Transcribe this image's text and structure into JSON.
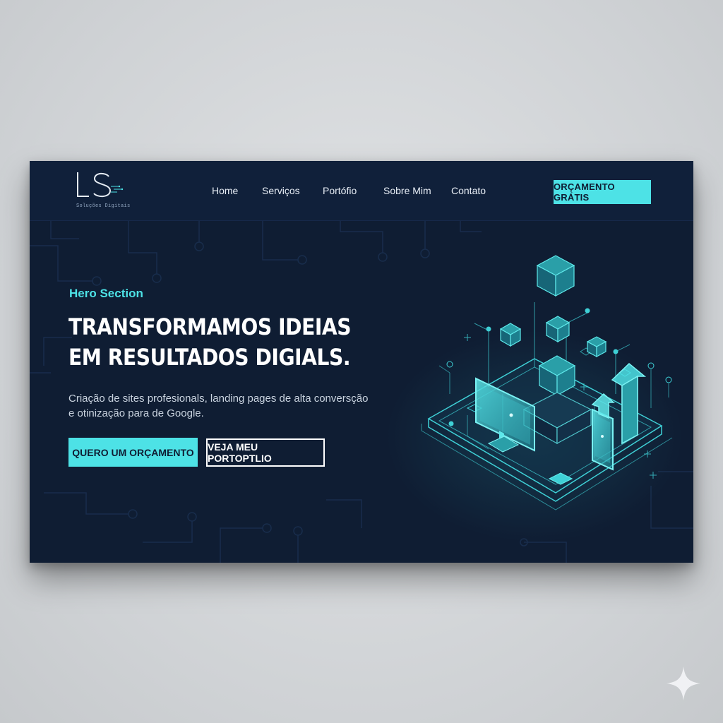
{
  "brand": {
    "logo_text": "LS",
    "tagline": "Soluções Digitais"
  },
  "nav": {
    "items": [
      {
        "label": "Home"
      },
      {
        "label": "Serviços"
      },
      {
        "label": "Portófio"
      },
      {
        "label": "Sobre Mim"
      },
      {
        "label": "Contato"
      }
    ],
    "cta_label": "ORÇAMENTO GRÁTIS"
  },
  "hero": {
    "section_label": "Hero Section",
    "title_lines": [
      "TRANSFORMAMOS IDEIAS",
      "EM RESULTADOS DIGIALS."
    ],
    "subtitle_lines": [
      "Criação de sites profesionals, landing pages de alta conversção",
      "e otinização para de Google."
    ],
    "primary_button": "QUERO UM ORÇAMENTO",
    "secondary_button": "VEJA MEU PORTOPTLIO"
  },
  "illustration": {
    "icons": [
      "cube-icon",
      "monitor-icon",
      "smartphone-icon",
      "growth-arrow-icon",
      "circuit-board-icon"
    ]
  },
  "colors": {
    "background": "#0f1d33",
    "navbar": "#10203a",
    "accent": "#4de2e6",
    "text_primary": "#ffffff",
    "text_muted": "#c9d3df"
  }
}
